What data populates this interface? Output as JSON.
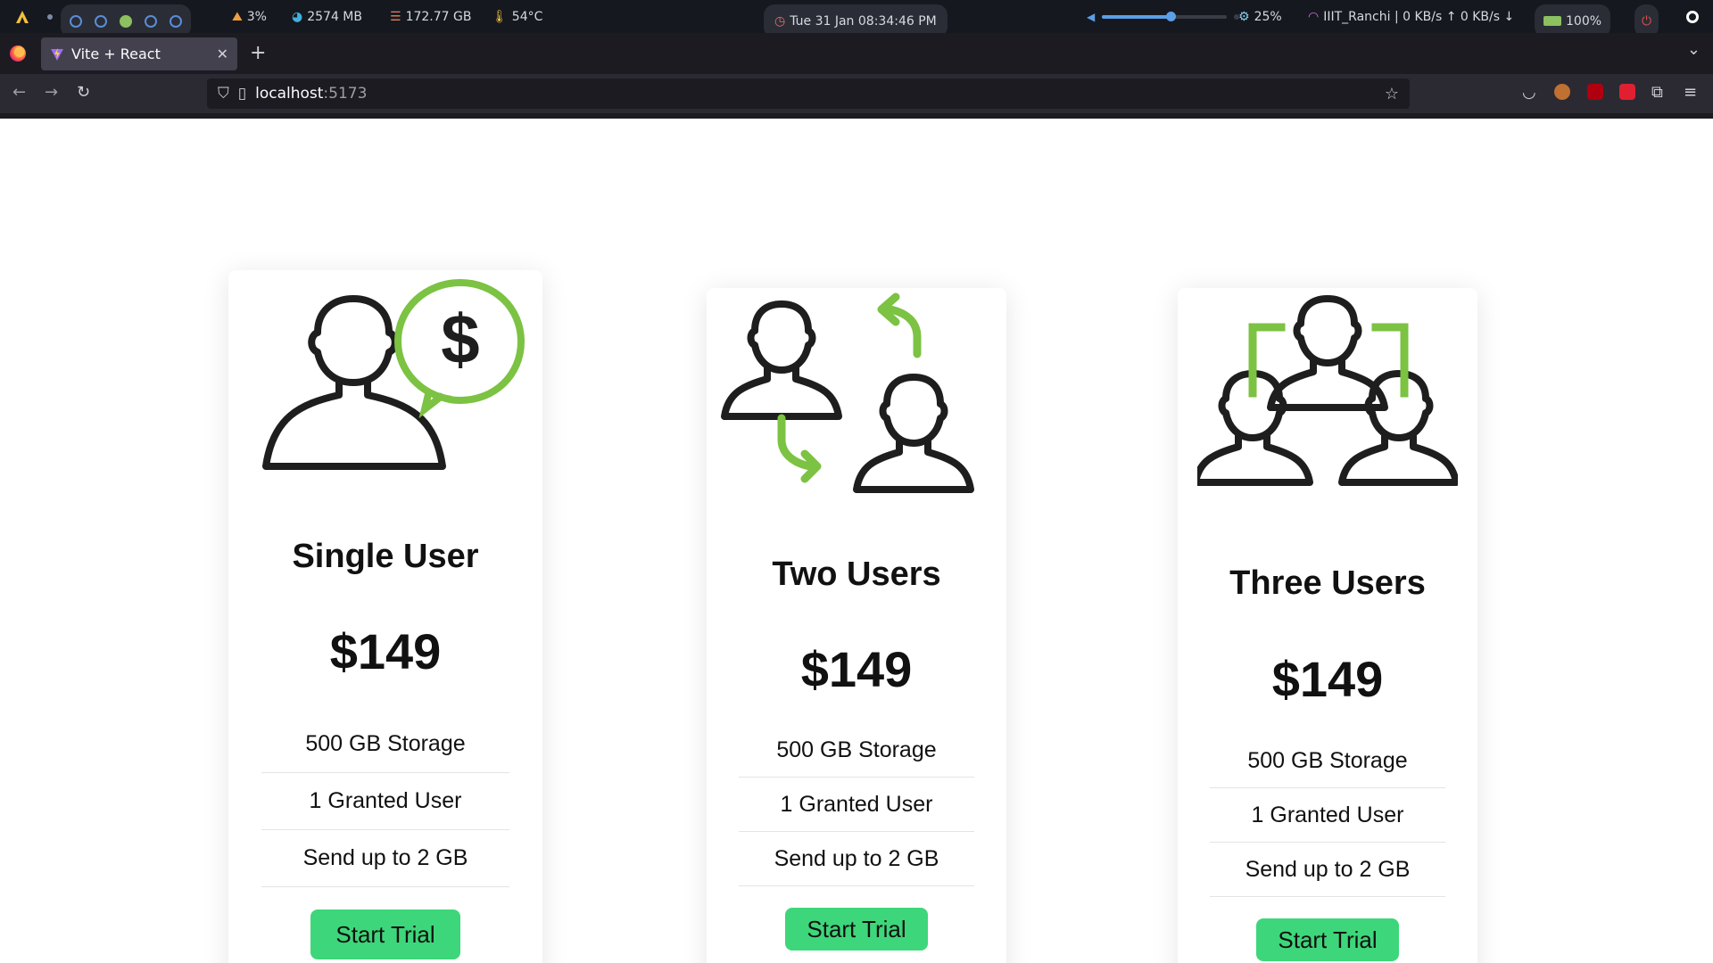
{
  "system_bar": {
    "cpu": "3%",
    "memory": "2574 MB",
    "disk": "172.77 GB",
    "temperature": "54°C",
    "datetime": "Tue 31 Jan 08:34:46 PM",
    "volume_level": 0.55,
    "brightness": "25%",
    "network": "IIIT_Ranchi | 0 KB/s ↑ 0 KB/s ↓",
    "battery": "100%"
  },
  "browser": {
    "tab_title": "Vite + React",
    "url_host": "localhost",
    "url_port": ":5173"
  },
  "plans": [
    {
      "title": "Single User",
      "price": "$149",
      "features": [
        "500 GB Storage",
        "1 Granted User",
        "Send up to 2 GB"
      ],
      "cta": "Start Trial",
      "icon": "user-dollar-icon"
    },
    {
      "title": "Two Users",
      "price": "$149",
      "features": [
        "500 GB Storage",
        "1 Granted User",
        "Send up to 2 GB"
      ],
      "cta": "Start Trial",
      "icon": "two-users-exchange-icon"
    },
    {
      "title": "Three Users",
      "price": "$149",
      "features": [
        "500 GB Storage",
        "1 Granted User",
        "Send up to 2 GB"
      ],
      "cta": "Start Trial",
      "icon": "three-users-group-icon"
    }
  ],
  "colors": {
    "accent_green": "#7cc243",
    "button_green": "#3ed67a",
    "icon_dark": "#1e1e1e"
  }
}
